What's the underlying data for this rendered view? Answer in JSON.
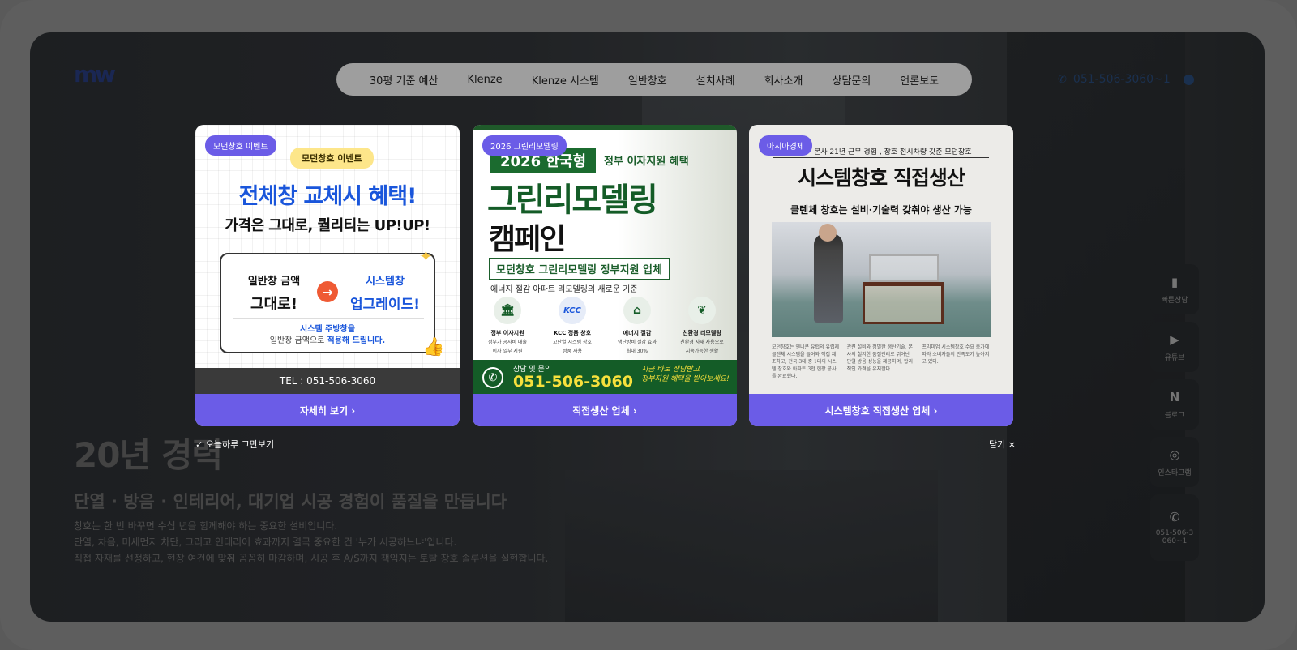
{
  "header": {
    "logo_mark": "mw",
    "logo_text": "",
    "nav": [
      "30평 기준 예산",
      "Klenze",
      "Klenze 시스템",
      "일반창호",
      "설치사례",
      "회사소개",
      "상담문의",
      "언론보도"
    ],
    "phone": "051-506-3060~1"
  },
  "hero": {
    "title": "20년 경력",
    "subtitle": "단열 · 방음 · 인테리어, 대기업 시공 경험이 품질을 만듭니다",
    "paragraph_1": "창호는 한 번 바꾸면 수십 년을 함께해야 하는 중요한 설비입니다.",
    "paragraph_2": "단열, 차음, 미세먼지 차단, 그리고 인테리어 효과까지 결국 중요한 건 '누가 시공하느냐'입니다.",
    "paragraph_3": "직접 자재를 선정하고, 현장 여건에 맞춰 꼼꼼히 마감하며, 시공 후 A/S까지 책임지는 토탈 창호 솔루션을 실현합니다."
  },
  "side_dock": [
    {
      "icon": "clipboard-icon",
      "glyph": "▮",
      "label": "빠른상담"
    },
    {
      "icon": "youtube-icon",
      "glyph": "▶",
      "label": "유튜브"
    },
    {
      "icon": "blog-icon",
      "glyph": "N",
      "label": "블로그"
    },
    {
      "icon": "instagram-icon",
      "glyph": "◎",
      "label": "인스타그램"
    },
    {
      "icon": "phone-icon",
      "glyph": "✆",
      "label": "051-506-3060~1"
    }
  ],
  "popups": {
    "p1": {
      "tag": "모던창호 이벤트",
      "pill": "모던창호 이벤트",
      "headline": "전체창 교체시 혜택!",
      "subheadline": "가격은 그대로, 퀄리티는 UP!UP!",
      "left_a": "일반창 금액",
      "left_b": "그대로!",
      "right_a": "시스템창",
      "right_b": "업그레이드!",
      "note_a": "시스템 주방창을",
      "note_b_prefix": "일반창 금액으로 ",
      "note_b_highlight": "적용해 드립니다.",
      "tel": "TEL : 051-506-3060",
      "cta": "자세히 보기 ›"
    },
    "p2": {
      "tag": "2026 그린리모델링",
      "year": "2026 한국형",
      "gov": "정부 이자지원 혜택",
      "big1": "그린리모델링",
      "big2": "캠페인",
      "band": "모던창호 그린리모델링 정부지원 업체",
      "small": "에너지 절감 아파트 리모델링의 새로운 기준",
      "features": [
        {
          "icon": "bank-icon",
          "glyph": "🏛",
          "title": "정부 이자지원",
          "desc1": "정부가 공사비 대출",
          "desc2": "이자 일부 지원"
        },
        {
          "icon": "kcc-logo-icon",
          "glyph": "KCC",
          "title": "KCC 정품 창호",
          "desc1": "고단열 시스템 창호",
          "desc2": "정품 사용"
        },
        {
          "icon": "house-icon",
          "glyph": "⌂",
          "title": "에너지 절감",
          "desc1": "냉난방비 절감 효과",
          "desc2": "최대 30%"
        },
        {
          "icon": "leaf-icon",
          "glyph": "❦",
          "title": "친환경 리모델링",
          "desc1": "친환경 자재 사용으로",
          "desc2": "지속가능한 생활"
        }
      ],
      "call_label": "상담 및 문의",
      "call_number": "051-506-3060",
      "handwriting_1": "지금 바로 상담받고",
      "handwriting_2": "정부지원 혜택을 받아보세요!",
      "cta": "직접생산 업체 ›"
    },
    "p3": {
      "tag": "아시아경제",
      "topline": "본사 21년 근무 경험 , 창호 전시차량 갖춘 모던창호",
      "headline": "시스템창호 직접생산",
      "subheadline": "클렌체 창호는 설비·기술력 갖춰야 생산 가능",
      "col1": "모던창호는 엔니콘 유럽의 유럽제 클렌체 시스템을 들여와 직접 제조하고, 전국 3대 중 1대의 시스템 창호와 아파트 3천 현장 공사를 완료했다.",
      "col2": "관련 설비와 정밀한 생산기술, 본사의 철저한 품질관리로 뛰어난 단열·방음 성능을 제공하며, 합리적인 가격을 유지한다.",
      "col3": "프리미엄 시스템창호 수요 증가에 따라 소비자들의 만족도가 높아지고 있다.",
      "cta": "시스템창호 직접생산 업체 ›"
    }
  },
  "dismiss_today": "✓ 오늘하루 그만보기",
  "close": "닫기 ×",
  "colors": {
    "accent": "#6b5ce7",
    "blue": "#1a56db",
    "green": "#145c27",
    "yellow": "#f7e03c"
  }
}
